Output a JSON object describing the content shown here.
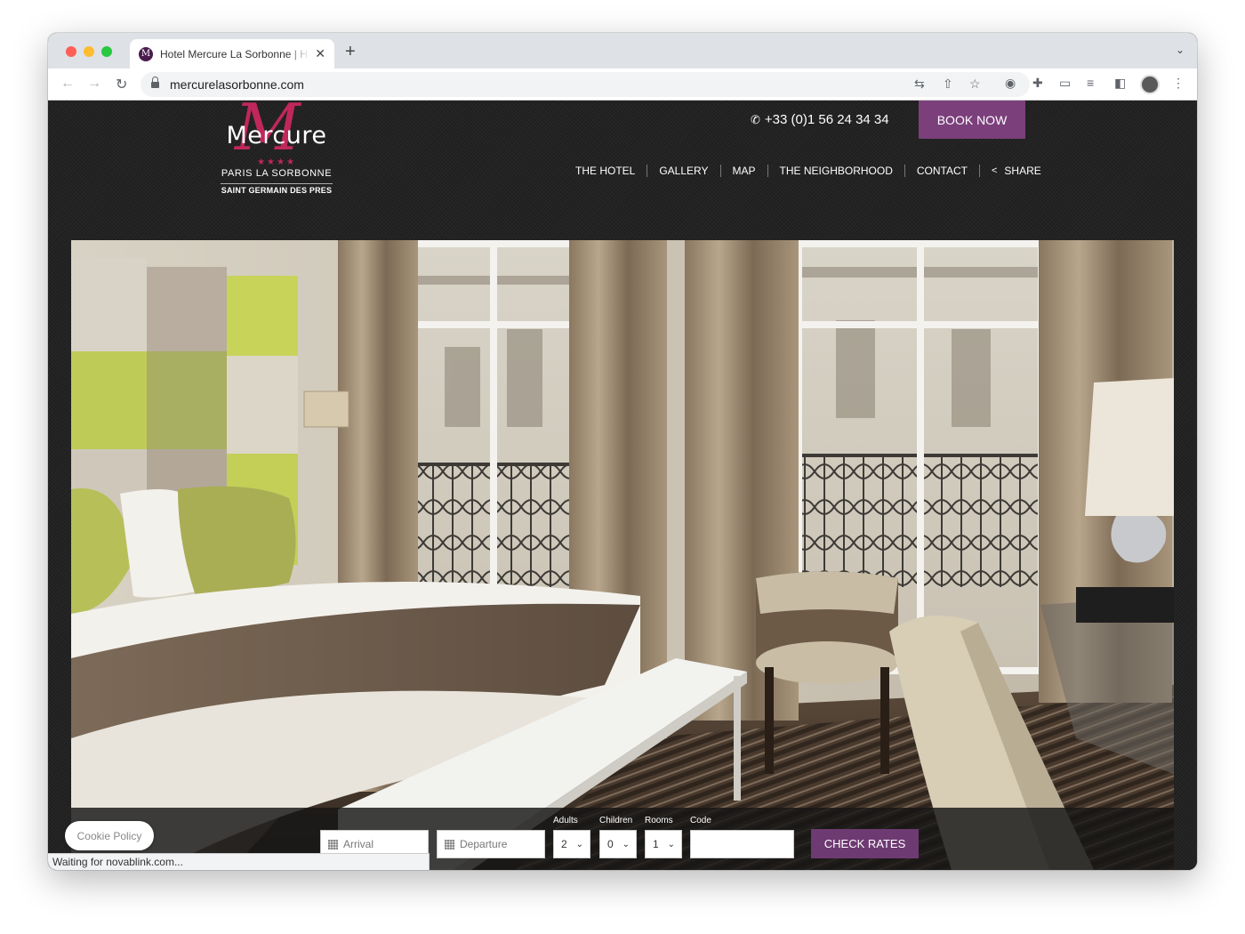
{
  "browser": {
    "tab_title": "Hotel Mercure La Sorbonne | Hotel Paris",
    "tab_favicon_letter": "M",
    "new_tab": "+",
    "tab_close": "✕",
    "url": "mercurelasorbonne.com",
    "status_text": "Waiting for novablink.com..."
  },
  "header": {
    "logo": {
      "wordmark": "Mercure",
      "stars": "★★★★",
      "line1": "PARIS LA SORBONNE",
      "line2": "SAINT GERMAIN DES PRES"
    },
    "phone": "+33 (0)1 56 24 34 34",
    "book_now": "BOOK NOW",
    "nav": {
      "hotel": "THE HOTEL",
      "gallery": "GALLERY",
      "map": "MAP",
      "neighborhood": "THE NEIGHBORHOOD",
      "contact": "CONTACT",
      "share": "SHARE"
    }
  },
  "booking": {
    "arrival_placeholder": "Arrival",
    "departure_placeholder": "Departure",
    "adults_label": "Adults",
    "adults_value": "2",
    "children_label": "Children",
    "children_value": "0",
    "rooms_label": "Rooms",
    "rooms_value": "1",
    "code_label": "Code",
    "check_rates": "CHECK RATES"
  },
  "cookie_policy": "Cookie Policy",
  "colors": {
    "brand_purple": "#7b3f7c",
    "logo_magenta": "#c0275c",
    "page_background": "#232323"
  }
}
